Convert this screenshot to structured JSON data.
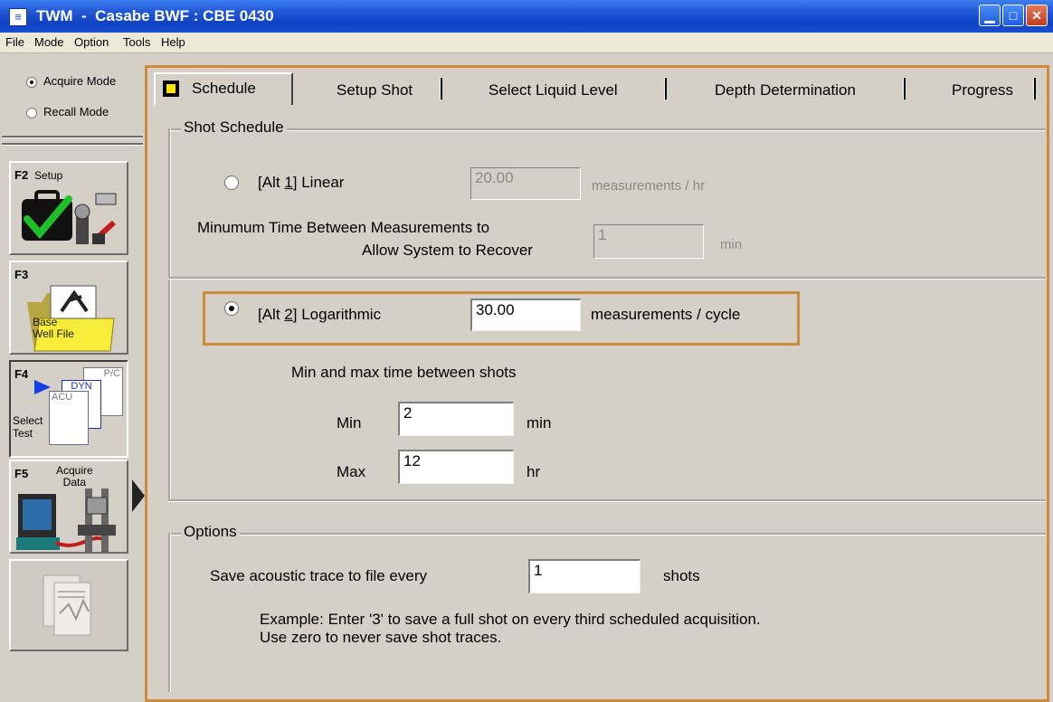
{
  "window": {
    "title": "TWM  -  Casabe BWF : CBE 0430",
    "app_icon": "twm-app-icon"
  },
  "menu": [
    "File",
    "Mode",
    "Option",
    "Tools",
    "Help"
  ],
  "modes": {
    "acquire": "Acquire Mode",
    "recall": "Recall Mode",
    "selected": "Acquire Mode"
  },
  "fbuttons": {
    "f2": {
      "key": "F2",
      "label": "Setup"
    },
    "f3": {
      "key": "F3",
      "label": "Base\nWell File"
    },
    "f4": {
      "key": "F4",
      "label": "Select\nTest",
      "docs": [
        "P/C",
        "DYN",
        "ACU"
      ]
    },
    "f5": {
      "key": "F5",
      "label": "Acquire\nData"
    }
  },
  "tabs": [
    "Schedule",
    "Setup Shot",
    "Select Liquid Level",
    "Depth Determination",
    "Progress"
  ],
  "active_tab": "Schedule",
  "shot_schedule": {
    "group_title": "Shot Schedule",
    "alt1": {
      "label_prefix": "[Alt ",
      "label_key": "1",
      "label_suffix": "]  Linear",
      "value": "20.00",
      "unit": "measurements / hr"
    },
    "min_time_label_1": "Minumum Time Between Measurements to",
    "min_time_label_2": "Allow System to Recover",
    "min_time_value": "1",
    "min_time_unit": "min",
    "alt2": {
      "label_prefix": "[Alt ",
      "label_key": "2",
      "label_suffix": "]  Logarithmic",
      "value": "30.00",
      "unit": "measurements / cycle"
    },
    "minmax_title": "Min and max time between shots",
    "min_label": "Min",
    "min_value": "2",
    "min_unit": "min",
    "max_label": "Max",
    "max_value": "12",
    "max_unit": "hr"
  },
  "options": {
    "group_title": "Options",
    "save_label": "Save acoustic trace to file every",
    "save_value": "1",
    "save_unit": "shots",
    "example_1": "Example: Enter '3' to save a full shot on every third scheduled acquisition.",
    "example_2": "Use zero to never save shot traces."
  },
  "colors": {
    "highlight": "#d08a3c",
    "titlebar": "#2258d6",
    "face": "#d4d0c8"
  }
}
